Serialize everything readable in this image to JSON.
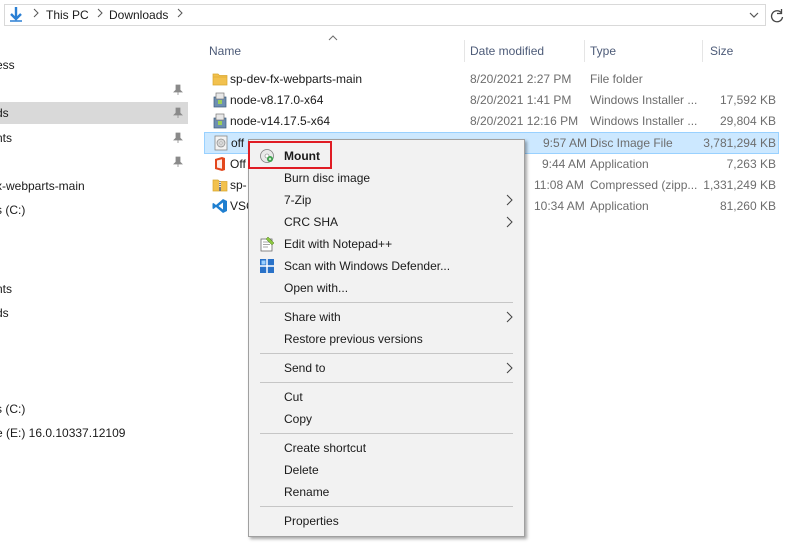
{
  "address": {
    "crumbs": [
      "This PC",
      "Downloads"
    ]
  },
  "nav": {
    "items": [
      {
        "label": "ess",
        "pinned": false,
        "selected": false
      },
      {
        "label": "",
        "pinned": true,
        "selected": false
      },
      {
        "label": "ds",
        "pinned": true,
        "selected": true
      },
      {
        "label": "nts",
        "pinned": true,
        "selected": false
      },
      {
        "label": "",
        "pinned": true,
        "selected": false
      },
      {
        "label": "x-webparts-main",
        "pinned": false,
        "selected": false
      },
      {
        "label": "s (C:)",
        "pinned": false,
        "selected": false
      },
      {
        "label": "nts",
        "pinned": false,
        "selected": false
      },
      {
        "label": "ds",
        "pinned": false,
        "selected": false
      },
      {
        "label": "s (C:)",
        "pinned": false,
        "selected": false
      },
      {
        "label": "e (E:) 16.0.10337.12109",
        "pinned": false,
        "selected": false
      }
    ]
  },
  "columns": {
    "name": "Name",
    "date": "Date modified",
    "type": "Type",
    "size": "Size"
  },
  "files": [
    {
      "name": "sp-dev-fx-webparts-main",
      "date": "8/20/2021 2:27 PM",
      "type": "File folder",
      "size": "",
      "icon": "folder-icon"
    },
    {
      "name": "node-v8.17.0-x64",
      "date": "8/20/2021 1:41 PM",
      "type": "Windows Installer ...",
      "size": "17,592 KB",
      "icon": "msi-installer-icon"
    },
    {
      "name": "node-v14.17.5-x64",
      "date": "8/20/2021 12:16 PM",
      "type": "Windows Installer ...",
      "size": "29,804 KB",
      "icon": "msi-installer-icon"
    },
    {
      "name": "off",
      "date": "9:57 AM",
      "type": "Disc Image File",
      "size": "3,781,294 KB",
      "icon": "disc-image-icon",
      "selected": true
    },
    {
      "name": "Off",
      "date": "9:44 AM",
      "type": "Application",
      "size": "7,263 KB",
      "icon": "office-icon"
    },
    {
      "name": "sp-",
      "date": "11:08 AM",
      "type": "Compressed (zipp...",
      "size": "1,331,249 KB",
      "icon": "zip-folder-icon"
    },
    {
      "name": "VSC",
      "date": "10:34 AM",
      "type": "Application",
      "size": "81,260 KB",
      "icon": "vscode-icon"
    }
  ],
  "context_menu": {
    "items": [
      {
        "label": "Mount",
        "bold": true,
        "icon": "disc-mount-icon",
        "submenu": false
      },
      {
        "label": "Burn disc image",
        "submenu": false
      },
      {
        "label": "7-Zip",
        "submenu": true
      },
      {
        "label": "CRC SHA",
        "submenu": true
      },
      {
        "label": "Edit with Notepad++",
        "icon": "notepadpp-icon",
        "submenu": false
      },
      {
        "label": "Scan with Windows Defender...",
        "icon": "defender-icon",
        "submenu": false
      },
      {
        "label": "Open with...",
        "submenu": false
      },
      {
        "label": "Share with",
        "submenu": true
      },
      {
        "label": "Restore previous versions",
        "submenu": false
      },
      {
        "label": "Send to",
        "submenu": true
      },
      {
        "label": "Cut",
        "submenu": false
      },
      {
        "label": "Copy",
        "submenu": false
      },
      {
        "label": "Create shortcut",
        "submenu": false
      },
      {
        "label": "Delete",
        "submenu": false
      },
      {
        "label": "Rename",
        "submenu": false
      },
      {
        "label": "Properties",
        "submenu": false
      }
    ]
  },
  "colors": {
    "selection": "#cce8ff",
    "highlight_box": "#e01c24",
    "menu_bg": "#f2f2f2"
  }
}
